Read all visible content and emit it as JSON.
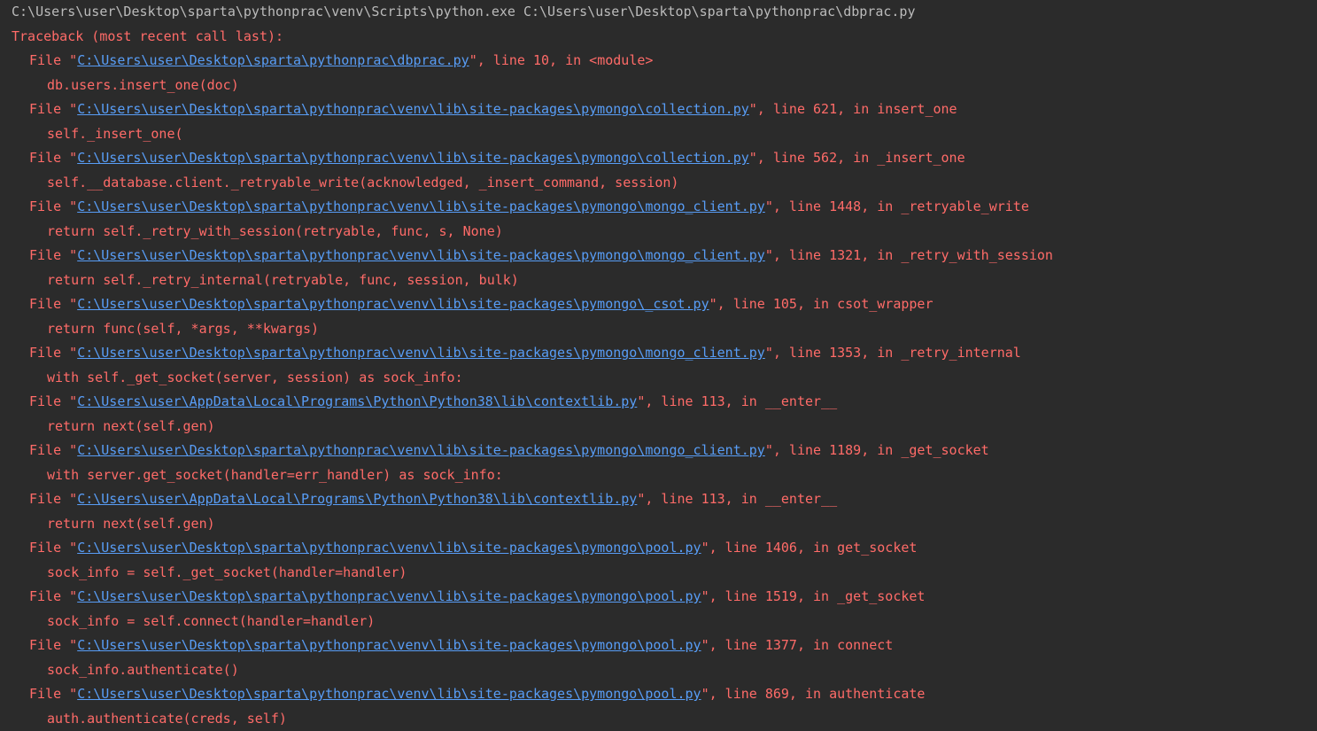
{
  "console": {
    "command": "C:\\Users\\user\\Desktop\\sparta\\pythonprac\\venv\\Scripts\\python.exe C:\\Users\\user\\Desktop\\sparta\\pythonprac\\dbprac.py",
    "traceback_header": "Traceback (most recent call last):",
    "frames": [
      {
        "path": "C:\\Users\\user\\Desktop\\sparta\\pythonprac\\dbprac.py",
        "suffix": "\", line 10, in <module>",
        "code": "db.users.insert_one(doc)"
      },
      {
        "path": "C:\\Users\\user\\Desktop\\sparta\\pythonprac\\venv\\lib\\site-packages\\pymongo\\collection.py",
        "suffix": "\", line 621, in insert_one",
        "code": "self._insert_one("
      },
      {
        "path": "C:\\Users\\user\\Desktop\\sparta\\pythonprac\\venv\\lib\\site-packages\\pymongo\\collection.py",
        "suffix": "\", line 562, in _insert_one",
        "code": "self.__database.client._retryable_write(acknowledged, _insert_command, session)"
      },
      {
        "path": "C:\\Users\\user\\Desktop\\sparta\\pythonprac\\venv\\lib\\site-packages\\pymongo\\mongo_client.py",
        "suffix": "\", line 1448, in _retryable_write",
        "code": "return self._retry_with_session(retryable, func, s, None)"
      },
      {
        "path": "C:\\Users\\user\\Desktop\\sparta\\pythonprac\\venv\\lib\\site-packages\\pymongo\\mongo_client.py",
        "suffix": "\", line 1321, in _retry_with_session",
        "code": "return self._retry_internal(retryable, func, session, bulk)"
      },
      {
        "path": "C:\\Users\\user\\Desktop\\sparta\\pythonprac\\venv\\lib\\site-packages\\pymongo\\_csot.py",
        "suffix": "\", line 105, in csot_wrapper",
        "code": "return func(self, *args, **kwargs)"
      },
      {
        "path": "C:\\Users\\user\\Desktop\\sparta\\pythonprac\\venv\\lib\\site-packages\\pymongo\\mongo_client.py",
        "suffix": "\", line 1353, in _retry_internal",
        "code": "with self._get_socket(server, session) as sock_info:"
      },
      {
        "path": "C:\\Users\\user\\AppData\\Local\\Programs\\Python\\Python38\\lib\\contextlib.py",
        "suffix": "\", line 113, in __enter__",
        "code": "return next(self.gen)"
      },
      {
        "path": "C:\\Users\\user\\Desktop\\sparta\\pythonprac\\venv\\lib\\site-packages\\pymongo\\mongo_client.py",
        "suffix": "\", line 1189, in _get_socket",
        "code": "with server.get_socket(handler=err_handler) as sock_info:"
      },
      {
        "path": "C:\\Users\\user\\AppData\\Local\\Programs\\Python\\Python38\\lib\\contextlib.py",
        "suffix": "\", line 113, in __enter__",
        "code": "return next(self.gen)"
      },
      {
        "path": "C:\\Users\\user\\Desktop\\sparta\\pythonprac\\venv\\lib\\site-packages\\pymongo\\pool.py",
        "suffix": "\", line 1406, in get_socket",
        "code": "sock_info = self._get_socket(handler=handler)"
      },
      {
        "path": "C:\\Users\\user\\Desktop\\sparta\\pythonprac\\venv\\lib\\site-packages\\pymongo\\pool.py",
        "suffix": "\", line 1519, in _get_socket",
        "code": "sock_info = self.connect(handler=handler)"
      },
      {
        "path": "C:\\Users\\user\\Desktop\\sparta\\pythonprac\\venv\\lib\\site-packages\\pymongo\\pool.py",
        "suffix": "\", line 1377, in connect",
        "code": "sock_info.authenticate()"
      },
      {
        "path": "C:\\Users\\user\\Desktop\\sparta\\pythonprac\\venv\\lib\\site-packages\\pymongo\\pool.py",
        "suffix": "\", line 869, in authenticate",
        "code": "auth.authenticate(creds, self)"
      }
    ]
  },
  "colors": {
    "background": "#2b2b2b",
    "command_text": "#bbbbbb",
    "error_text": "#ff6b68",
    "link": "#589df6"
  }
}
